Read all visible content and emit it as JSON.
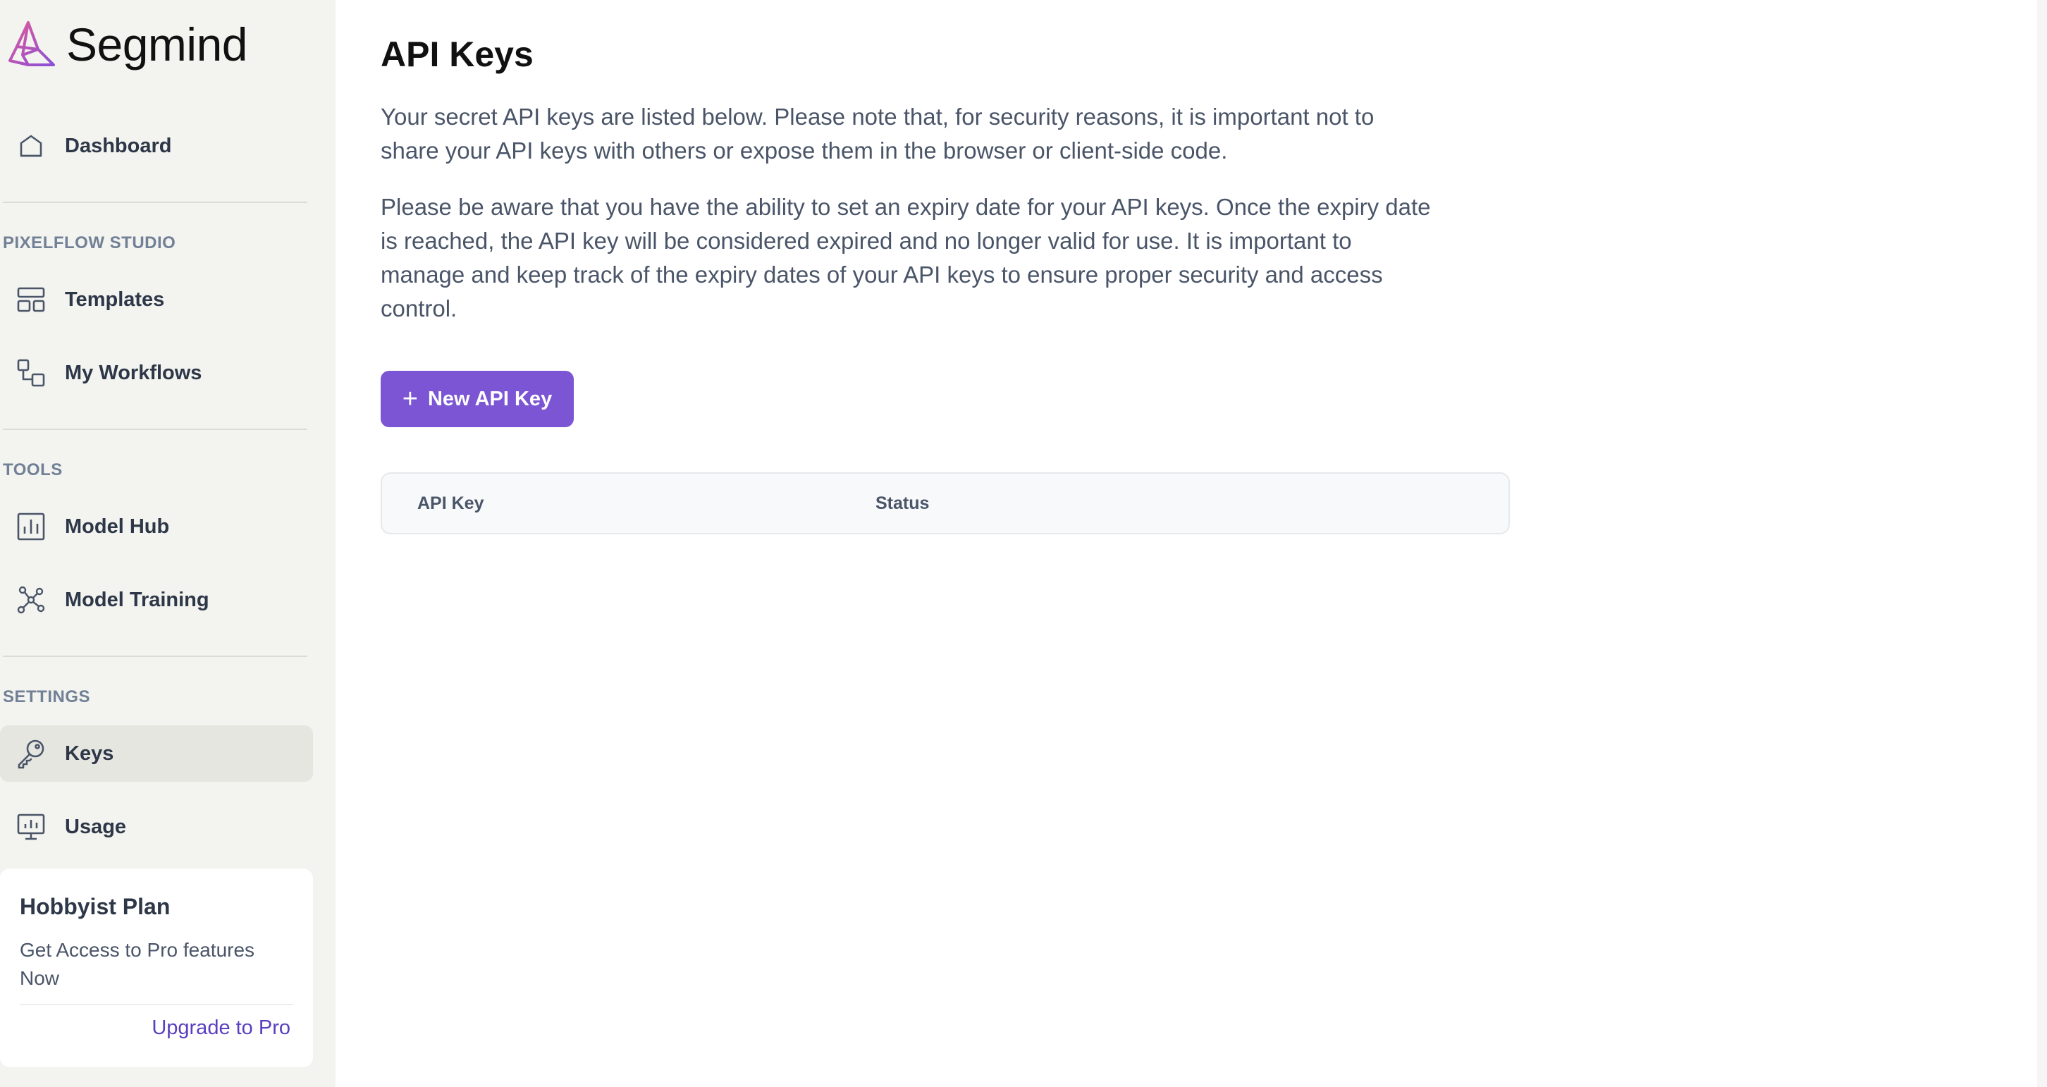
{
  "brand": {
    "name": "Segmind"
  },
  "sidebar": {
    "dashboard": {
      "label": "Dashboard"
    },
    "sections": {
      "pixelflow": "PIXELFLOW STUDIO",
      "tools": "TOOLS",
      "settings": "SETTINGS"
    },
    "items": {
      "templates": "Templates",
      "workflows": "My Workflows",
      "model_hub": "Model Hub",
      "model_training": "Model Training",
      "keys": "Keys",
      "usage": "Usage"
    },
    "active_item": "Keys"
  },
  "plan": {
    "title": "Hobbyist Plan",
    "description": "Get Access to Pro features Now",
    "upgrade_label": "Upgrade to Pro"
  },
  "main": {
    "title": "API Keys",
    "paragraph1": "Your secret API keys are listed below. Please note that, for security reasons, it is important not to share your API keys with others or expose them in the browser or client-side code.",
    "paragraph2": "Please be aware that you have the ability to set an expiry date for your API keys. Once the expiry date is reached, the API key will be considered expired and no longer valid for use. It is important to manage and keep track of the expiry dates of your API keys to ensure proper security and access control.",
    "new_key_button": "New API Key",
    "table": {
      "columns": [
        "API Key",
        "Status"
      ],
      "rows": []
    }
  },
  "colors": {
    "accent": "#7b55d4",
    "link": "#5a3fc0",
    "sidebar_bg": "#f3f3ef"
  }
}
